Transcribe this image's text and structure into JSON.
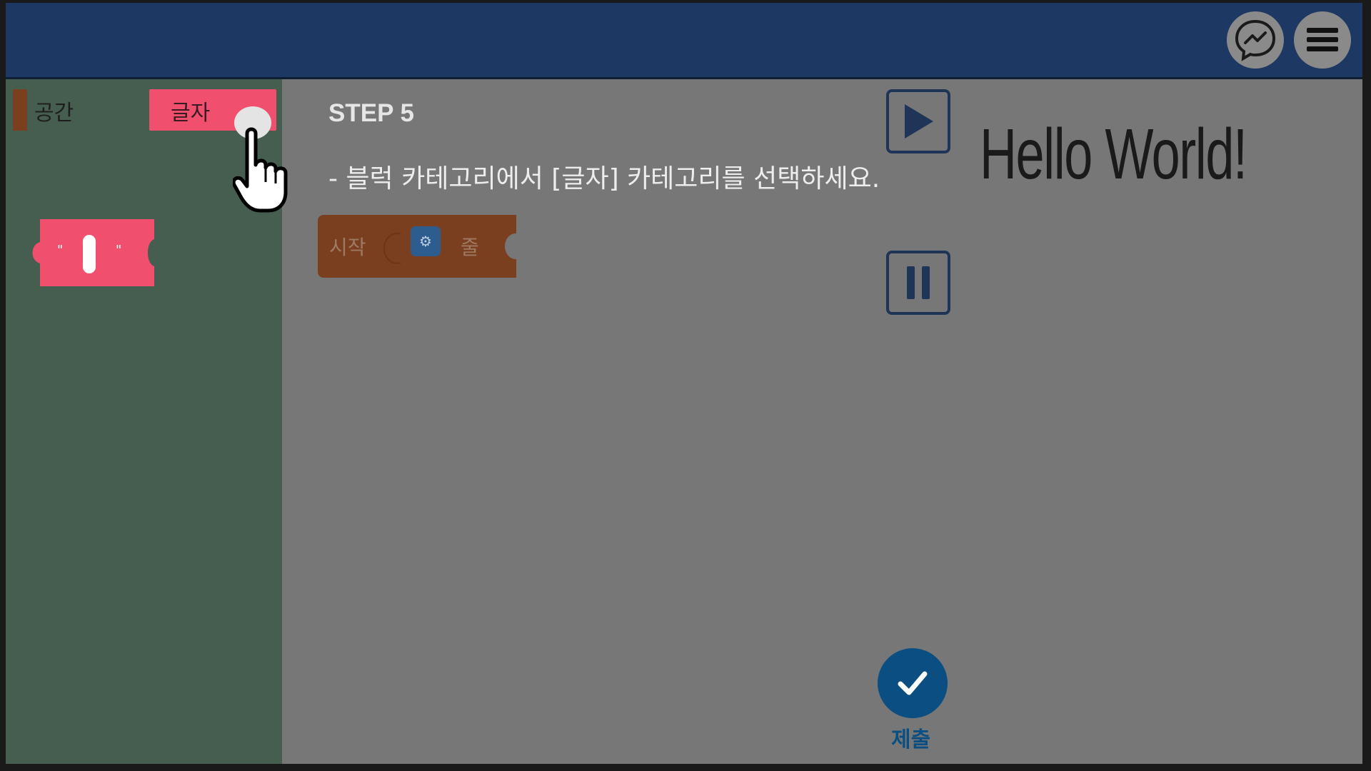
{
  "header": {
    "messenger_icon": "messenger-icon",
    "menu_icon": "hamburger-menu-icon",
    "bar_color": "#1d3862"
  },
  "sidebar": {
    "categories": [
      {
        "label": "공간",
        "color": "#7a3f1f",
        "selected": false
      },
      {
        "label": "글자",
        "color": "#f0506e",
        "selected": true
      }
    ],
    "blocks": [
      {
        "type": "text-string",
        "open_quote": "\"",
        "close_quote": "\"",
        "color": "#f0506e"
      }
    ]
  },
  "workspace": {
    "step_title": "STEP 5",
    "instruction": "- 블럭 카테고리에서 [글자] 카테고리를 선택하세요.",
    "blocks": {
      "start_label": "시작",
      "line_label": "줄"
    }
  },
  "controls": {
    "play_icon": "play-icon",
    "pause_icon": "pause-icon"
  },
  "output": {
    "text": "Hello World!"
  },
  "submit": {
    "label": "제출",
    "icon": "checkmark-icon",
    "color": "#0b4e82"
  }
}
